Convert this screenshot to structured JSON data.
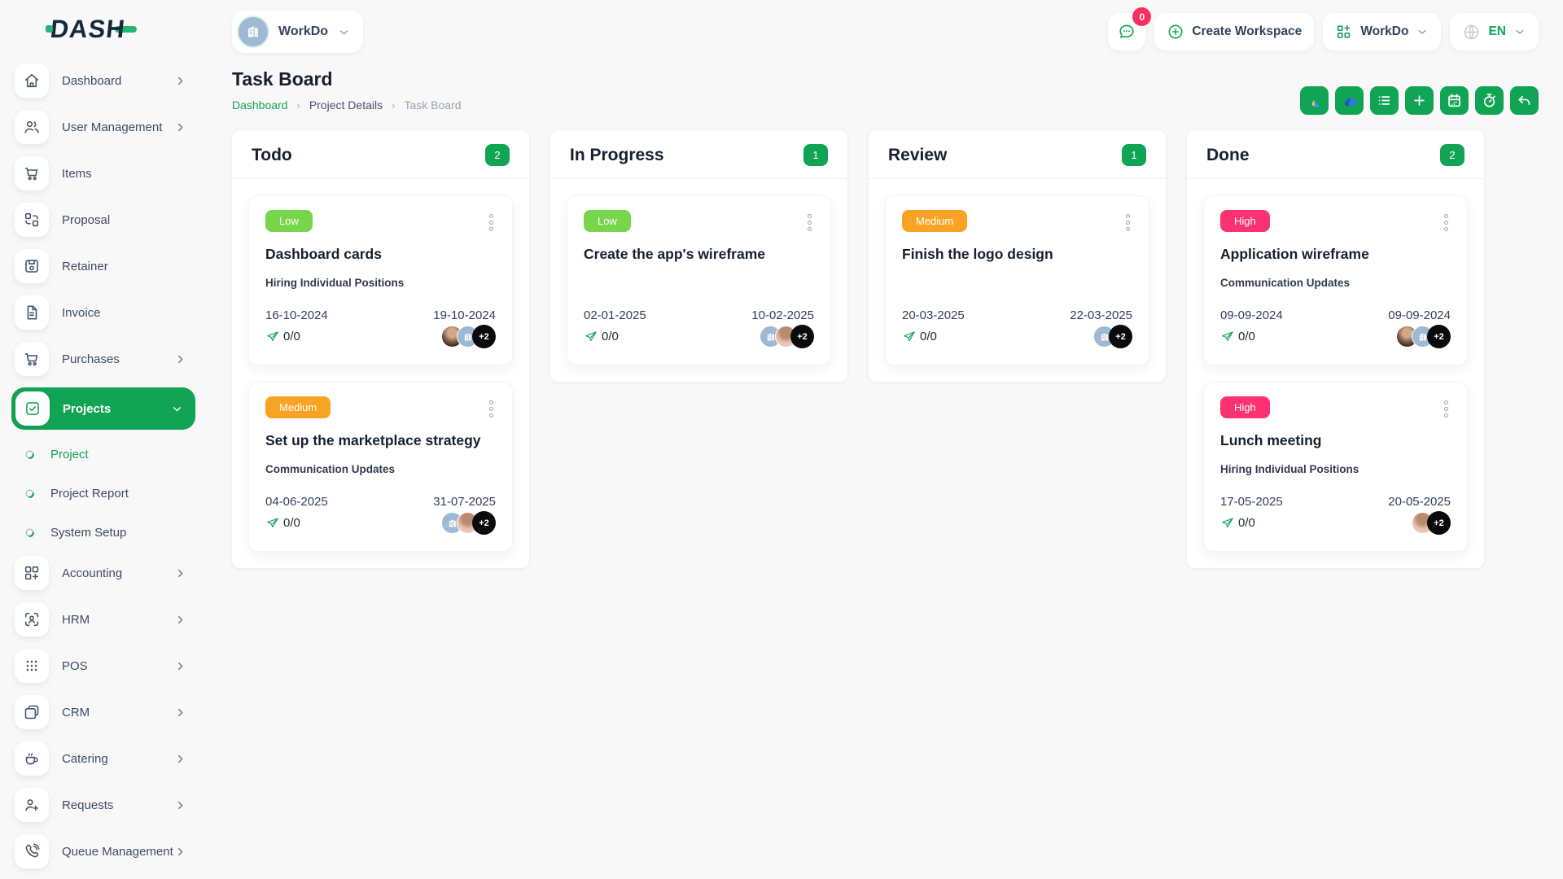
{
  "brand": {
    "name": "DASH"
  },
  "topbar": {
    "workspace_switcher": {
      "label": "WorkDo",
      "avatar": "building-logo"
    },
    "messages": {
      "badge": "0"
    },
    "create_workspace_label": "Create Workspace",
    "apps_menu_label": "WorkDo",
    "language_label": "EN"
  },
  "page": {
    "title": "Task Board",
    "breadcrumb": [
      "Dashboard",
      "Project Details",
      "Task Board"
    ]
  },
  "toolbar": {
    "buttons": [
      {
        "name": "google-drive"
      },
      {
        "name": "onedrive"
      },
      {
        "name": "list"
      },
      {
        "name": "add"
      },
      {
        "name": "calendar"
      },
      {
        "name": "timer"
      },
      {
        "name": "undo"
      }
    ]
  },
  "sidebar": {
    "items": [
      {
        "label": "Dashboard",
        "icon": "home",
        "expandable": true
      },
      {
        "label": "User Management",
        "icon": "users",
        "expandable": true
      },
      {
        "label": "Items",
        "icon": "cart",
        "expandable": false
      },
      {
        "label": "Proposal",
        "icon": "proposal",
        "expandable": false
      },
      {
        "label": "Retainer",
        "icon": "retainer",
        "expandable": false
      },
      {
        "label": "Invoice",
        "icon": "invoice",
        "expandable": false
      },
      {
        "label": "Purchases",
        "icon": "cart",
        "expandable": true
      },
      {
        "label": "Projects",
        "icon": "check-square",
        "expandable": true,
        "active": true,
        "expanded": true,
        "children": [
          {
            "label": "Project",
            "active": true
          },
          {
            "label": "Project Report",
            "active": false
          },
          {
            "label": "System Setup",
            "active": false
          }
        ]
      },
      {
        "label": "Accounting",
        "icon": "accounting",
        "expandable": true
      },
      {
        "label": "HRM",
        "icon": "hrm",
        "expandable": true
      },
      {
        "label": "POS",
        "icon": "pos",
        "expandable": true
      },
      {
        "label": "CRM",
        "icon": "crm",
        "expandable": true
      },
      {
        "label": "Catering",
        "icon": "catering",
        "expandable": true
      },
      {
        "label": "Requests",
        "icon": "requests",
        "expandable": true
      },
      {
        "label": "Queue Management",
        "icon": "queue",
        "expandable": true
      }
    ]
  },
  "board": {
    "columns": [
      {
        "title": "Todo",
        "count": "2",
        "cards": [
          {
            "priority": "Low",
            "priority_color": "low",
            "title": "Dashboard cards",
            "milestone": "Hiring Individual Positions",
            "start_date": "16-10-2024",
            "end_date": "19-10-2024",
            "progress": "0/0",
            "avatars": [
              {
                "type": "photo-female-1"
              },
              {
                "type": "workspace-logo"
              },
              {
                "type": "overflow",
                "label": "+2"
              }
            ]
          },
          {
            "priority": "Medium",
            "priority_color": "medium",
            "title": "Set up the marketplace strategy",
            "milestone": "Communication Updates",
            "start_date": "04-06-2025",
            "end_date": "31-07-2025",
            "progress": "0/0",
            "avatars": [
              {
                "type": "workspace-logo"
              },
              {
                "type": "photo-female-2"
              },
              {
                "type": "overflow",
                "label": "+2"
              }
            ]
          }
        ]
      },
      {
        "title": "In Progress",
        "count": "1",
        "cards": [
          {
            "priority": "Low",
            "priority_color": "low",
            "title": "Create the app's wireframe",
            "milestone": "",
            "start_date": "02-01-2025",
            "end_date": "10-02-2025",
            "progress": "0/0",
            "avatars": [
              {
                "type": "workspace-logo"
              },
              {
                "type": "photo-female-2"
              },
              {
                "type": "overflow",
                "label": "+2"
              }
            ]
          }
        ]
      },
      {
        "title": "Review",
        "count": "1",
        "cards": [
          {
            "priority": "Medium",
            "priority_color": "medium",
            "title": "Finish the logo design",
            "milestone": "",
            "start_date": "20-03-2025",
            "end_date": "22-03-2025",
            "progress": "0/0",
            "avatars": [
              {
                "type": "workspace-logo"
              },
              {
                "type": "overflow",
                "label": "+2"
              }
            ]
          }
        ]
      },
      {
        "title": "Done",
        "count": "2",
        "cards": [
          {
            "priority": "High",
            "priority_color": "high",
            "title": "Application wireframe",
            "milestone": "Communication Updates",
            "start_date": "09-09-2024",
            "end_date": "09-09-2024",
            "progress": "0/0",
            "avatars": [
              {
                "type": "photo-female-1"
              },
              {
                "type": "workspace-logo"
              },
              {
                "type": "overflow",
                "label": "+2"
              }
            ]
          },
          {
            "priority": "High",
            "priority_color": "high",
            "title": "Lunch meeting",
            "milestone": "Hiring Individual Positions",
            "start_date": "17-05-2025",
            "end_date": "20-05-2025",
            "progress": "0/0",
            "avatars": [
              {
                "type": "photo-female-2"
              },
              {
                "type": "overflow",
                "label": "+2"
              }
            ]
          }
        ]
      }
    ]
  },
  "colors": {
    "primary": "#12A455",
    "low": "#77D64C",
    "medium": "#F9A325",
    "high": "#FB3272",
    "notification": "#FB2D5E"
  }
}
